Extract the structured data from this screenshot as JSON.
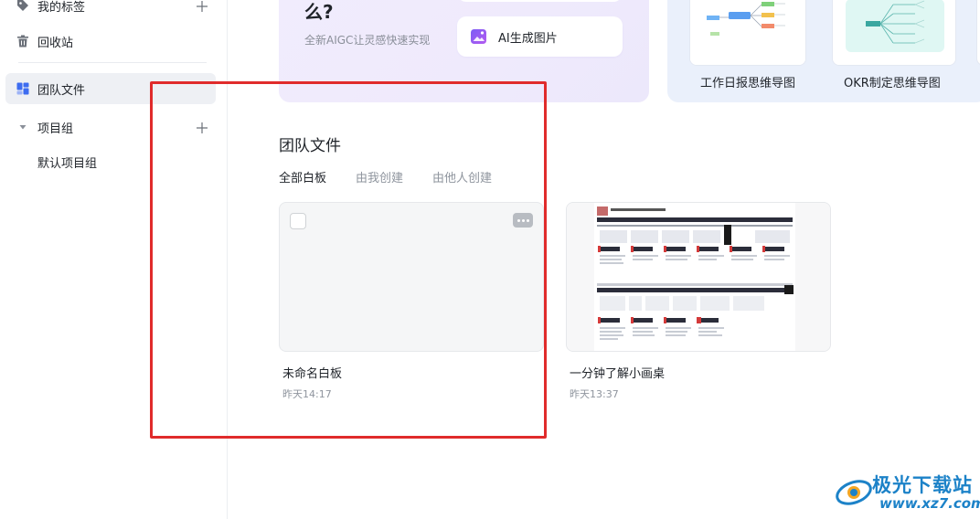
{
  "sidebar": {
    "items": [
      {
        "label": "我的标签",
        "icon": "tag-icon",
        "has_add": true
      },
      {
        "label": "回收站",
        "icon": "trash-icon"
      },
      {
        "label": "团队文件",
        "icon": "team-files-icon",
        "active": true
      },
      {
        "label": "项目组",
        "icon": "chevron-down-icon",
        "has_add": true
      }
    ],
    "sub_item": "默认项目组"
  },
  "ai_banner": {
    "question_tail": "么?",
    "subtitle": "全新AIGC让灵感快速实现",
    "button_label": "AI生成图片",
    "button_icon": "image-magic-icon"
  },
  "templates": [
    {
      "label": "工作日报思维导图"
    },
    {
      "label": "OKR制定思维导图"
    }
  ],
  "section": {
    "title": "团队文件",
    "tabs": [
      "全部白板",
      "由我创建",
      "由他人创建"
    ],
    "active_tab": "全部白板"
  },
  "files": [
    {
      "name": "未命名白板",
      "time": "昨天14:17"
    },
    {
      "name": "一分钟了解小画桌",
      "time": "昨天13:37"
    }
  ],
  "watermark": {
    "title": "极光下载站",
    "url": "www.xz7.com"
  },
  "colors": {
    "accent_red": "#e02b2b",
    "sidebar_active": "#eef0f4",
    "ai_card_bg": "#f0ebfd",
    "template_card_bg": "#eaf0fb",
    "watermark_blue": "#1c82c8"
  }
}
